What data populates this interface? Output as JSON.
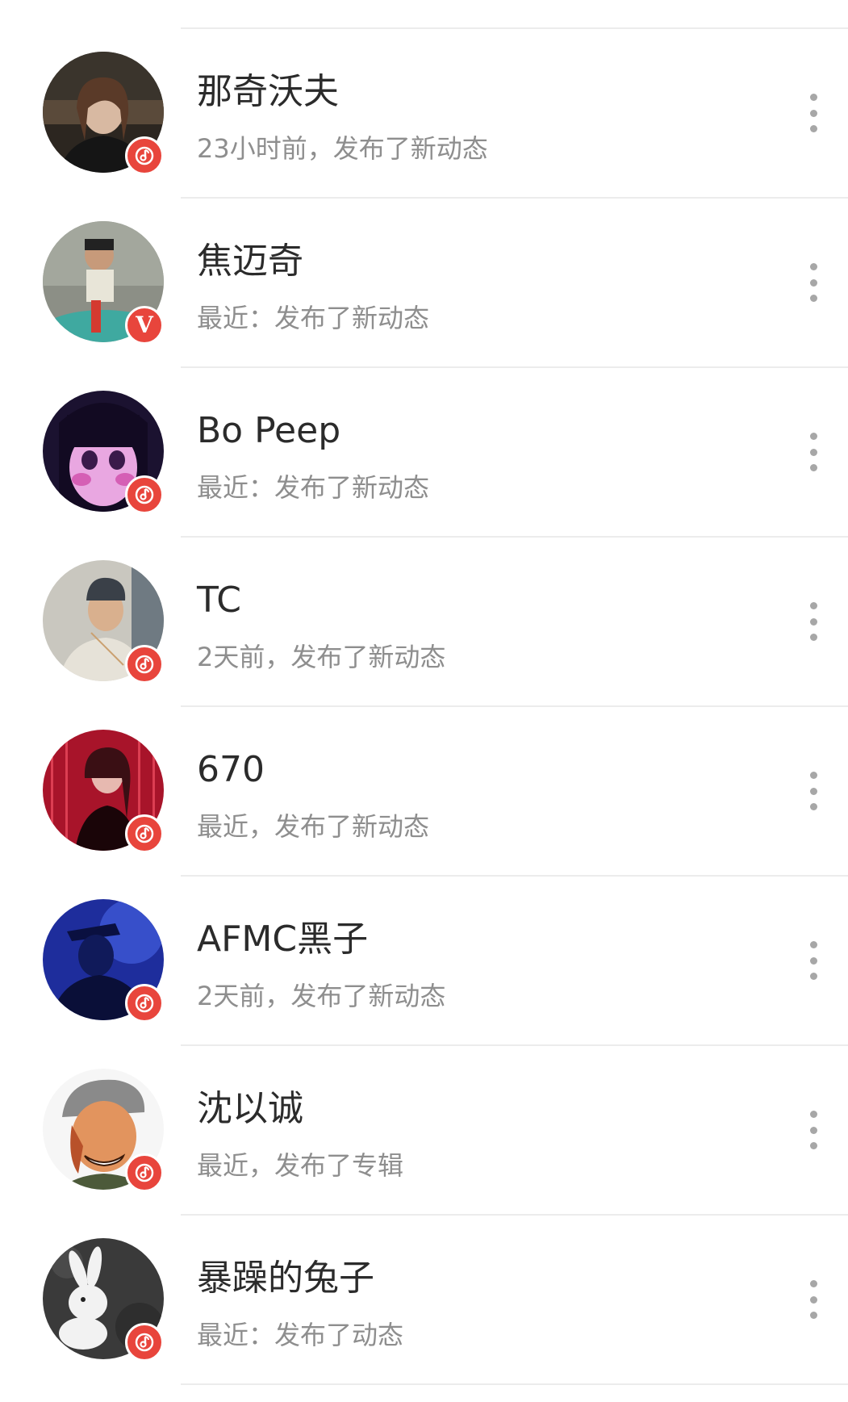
{
  "icons": {
    "badge_music": "music-note-badge-icon",
    "badge_verified": "verified-v-badge-icon",
    "more": "more-vertical-icon"
  },
  "colors": {
    "badge": "#e8453c",
    "name": "#2b2b2b",
    "status": "#8e8e8e",
    "divider": "#ececec"
  },
  "users": [
    {
      "name": "那奇沃夫",
      "status": "23小时前，发布了新动态",
      "badge": "music"
    },
    {
      "name": "焦迈奇",
      "status": "最近：发布了新动态",
      "badge": "verified",
      "badge_text": "V"
    },
    {
      "name": "Bo Peep",
      "status": "最近：发布了新动态",
      "badge": "music"
    },
    {
      "name": "TC",
      "status": "2天前，发布了新动态",
      "badge": "music"
    },
    {
      "name": "670",
      "status": "最近，发布了新动态",
      "badge": "music"
    },
    {
      "name": "AFMC黑子",
      "status": "2天前，发布了新动态",
      "badge": "music"
    },
    {
      "name": "沈以诚",
      "status": "最近，发布了专辑",
      "badge": "music"
    },
    {
      "name": "暴躁的兔子",
      "status": "最近：发布了动态",
      "badge": "music"
    }
  ]
}
